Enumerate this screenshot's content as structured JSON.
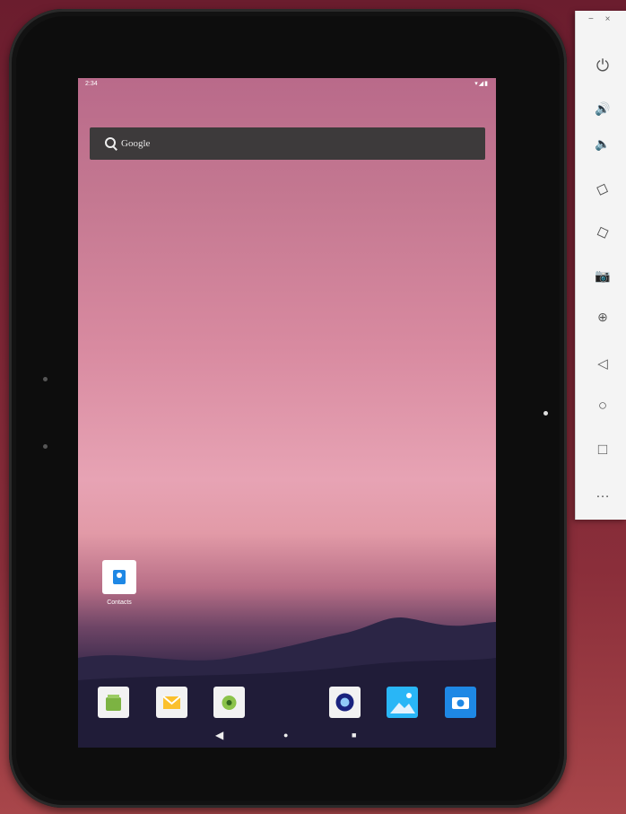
{
  "status_bar": {
    "time": "2:34",
    "icons": "▾◢▮"
  },
  "search": {
    "label": "Google"
  },
  "home_apps": [
    {
      "label": "Contacts"
    }
  ],
  "dock_apps": [
    {
      "name": "market-icon",
      "color": "#7cb342"
    },
    {
      "name": "email-icon",
      "color": "#fbc02d"
    },
    {
      "name": "android-icon",
      "color": "#8bc34a"
    },
    {
      "name": "camera-lens-icon",
      "color": "#1a237e"
    },
    {
      "name": "gallery-icon",
      "color": "#29b6f6"
    },
    {
      "name": "camera-icon",
      "color": "#1e88e5"
    }
  ],
  "nav": {
    "back": "◀",
    "home": "●",
    "recents": "■"
  },
  "window_controls": {
    "minimize": "−",
    "close": "×"
  },
  "toolbar": [
    {
      "name": "power-icon",
      "glyph": "⏻"
    },
    {
      "name": "volume-up-icon",
      "glyph": "🔊"
    },
    {
      "name": "volume-down-icon",
      "glyph": "🔈"
    },
    {
      "name": "rotate-left-icon",
      "glyph": "◇"
    },
    {
      "name": "rotate-right-icon",
      "glyph": "◇"
    },
    {
      "name": "screenshot-icon",
      "glyph": "📷"
    },
    {
      "name": "zoom-icon",
      "glyph": "⊕"
    },
    {
      "name": "back-icon",
      "glyph": "◁"
    },
    {
      "name": "home-icon",
      "glyph": "○"
    },
    {
      "name": "overview-icon",
      "glyph": "□"
    },
    {
      "name": "more-icon",
      "glyph": "…"
    }
  ]
}
